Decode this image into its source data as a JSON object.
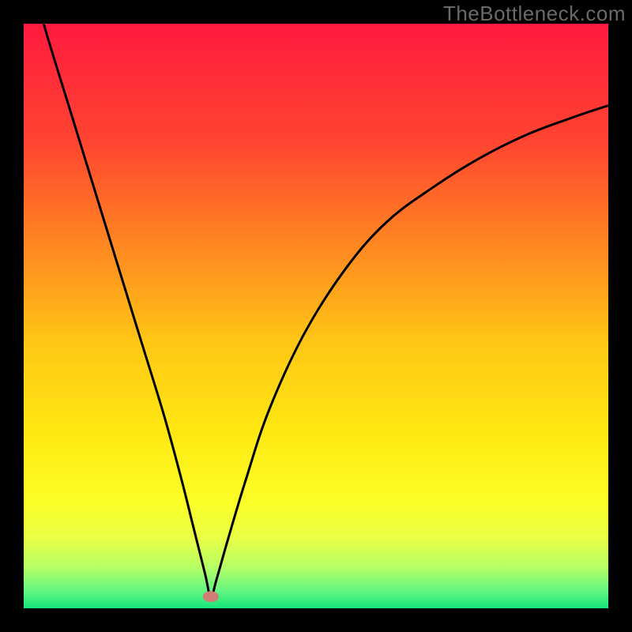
{
  "watermark": "TheBottleneck.com",
  "chart_data": {
    "type": "line",
    "title": "",
    "xlabel": "",
    "ylabel": "",
    "xlim": [
      0,
      100
    ],
    "ylim": [
      0,
      100
    ],
    "minimum_marker": {
      "x": 32,
      "y": 2,
      "color": "#cf7d75"
    },
    "series": [
      {
        "name": "bottleneck-curve",
        "x": [
          0,
          4,
          8,
          12,
          16,
          20,
          24,
          27,
          29,
          31,
          32,
          33,
          35,
          38,
          42,
          48,
          55,
          62,
          70,
          78,
          86,
          94,
          100
        ],
        "values": [
          112,
          98,
          85,
          72,
          59,
          46,
          33,
          22,
          14,
          6,
          2,
          5,
          12,
          22,
          34,
          47,
          58,
          66,
          72,
          77,
          81,
          84,
          86
        ]
      }
    ],
    "background_gradient": {
      "stops": [
        {
          "offset": 0.0,
          "color": "#ff1a3f"
        },
        {
          "offset": 0.2,
          "color": "#ff4430"
        },
        {
          "offset": 0.4,
          "color": "#ff8f20"
        },
        {
          "offset": 0.55,
          "color": "#ffc814"
        },
        {
          "offset": 0.7,
          "color": "#ffe812"
        },
        {
          "offset": 0.82,
          "color": "#fbff27"
        },
        {
          "offset": 0.88,
          "color": "#e8ff45"
        },
        {
          "offset": 0.93,
          "color": "#b6ff66"
        },
        {
          "offset": 0.97,
          "color": "#63f681"
        },
        {
          "offset": 1.0,
          "color": "#15e57a"
        }
      ]
    }
  }
}
